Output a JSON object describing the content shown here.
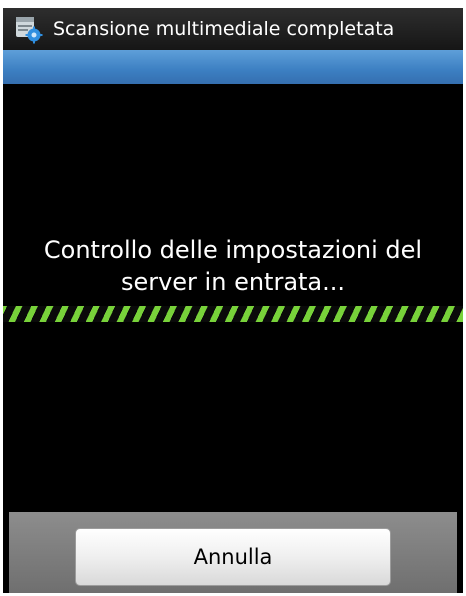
{
  "status_bar": {
    "icon": "media-scan-settings-icon",
    "notification_text": "Scansione multimediale completata"
  },
  "dialog": {
    "message": "Controllo delle impostazioni del server in entrata...",
    "progress": "indeterminate",
    "progress_color": "#78d23a",
    "title_bar_color": "#3c7fc2"
  },
  "buttons": {
    "cancel_label": "Annulla"
  }
}
